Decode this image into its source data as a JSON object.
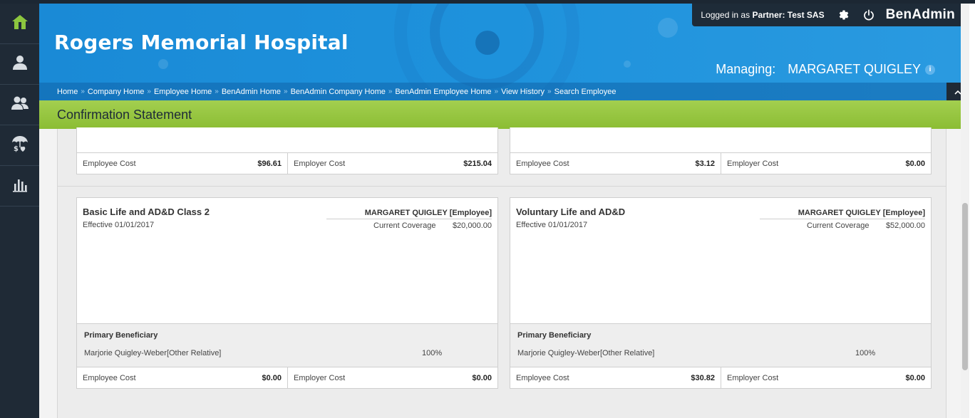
{
  "app": {
    "company_name": "Rogers Memorial Hospital",
    "brand": "BenAdmin",
    "logged_in_prefix": "Logged in as",
    "logged_in_role": "Partner:",
    "logged_in_user": "Test SAS",
    "managing_label": "Managing:",
    "managing_name": "MARGARET QUIGLEY",
    "info_glyph": "i",
    "page_title": "Confirmation Statement"
  },
  "colors": {
    "header_blue": "#1e92dc",
    "green_bar": "#98c643",
    "sidebar": "#1f2a36",
    "home_icon_green": "#8cc63f"
  },
  "sidebar": {
    "items": [
      {
        "icon": "home-icon"
      },
      {
        "icon": "employee-icon"
      },
      {
        "icon": "employees-icon"
      },
      {
        "icon": "benefits-umbrella-icon"
      },
      {
        "icon": "reports-chart-icon"
      }
    ]
  },
  "breadcrumb": {
    "separator": "»",
    "items": [
      "Home",
      "Company Home",
      "Employee Home",
      "BenAdmin Home",
      "BenAdmin Company Home",
      "BenAdmin Employee Home",
      "View History",
      "Search Employee"
    ]
  },
  "top_costs": [
    {
      "employee_label": "Employee Cost",
      "employee_value": "$96.61",
      "employer_label": "Employer Cost",
      "employer_value": "$215.04"
    },
    {
      "employee_label": "Employee Cost",
      "employee_value": "$3.12",
      "employer_label": "Employer Cost",
      "employer_value": "$0.00"
    }
  ],
  "plans": [
    {
      "title": "Basic Life and AD&D Class 2",
      "effective": "Effective 01/01/2017",
      "member": "MARGARET QUIGLEY [Employee]",
      "coverage_label": "Current Coverage",
      "coverage_value": "$20,000.00",
      "beneficiary_heading": "Primary Beneficiary",
      "beneficiary_name": "Marjorie Quigley-Weber[Other Relative]",
      "beneficiary_pct": "100%",
      "employee_label": "Employee Cost",
      "employee_value": "$0.00",
      "employer_label": "Employer Cost",
      "employer_value": "$0.00"
    },
    {
      "title": "Voluntary Life and AD&D",
      "effective": "Effective 01/01/2017",
      "member": "MARGARET QUIGLEY [Employee]",
      "coverage_label": "Current Coverage",
      "coverage_value": "$52,000.00",
      "beneficiary_heading": "Primary Beneficiary",
      "beneficiary_name": "Marjorie Quigley-Weber[Other Relative]",
      "beneficiary_pct": "100%",
      "employee_label": "Employee Cost",
      "employee_value": "$30.82",
      "employer_label": "Employer Cost",
      "employer_value": "$0.00"
    }
  ]
}
